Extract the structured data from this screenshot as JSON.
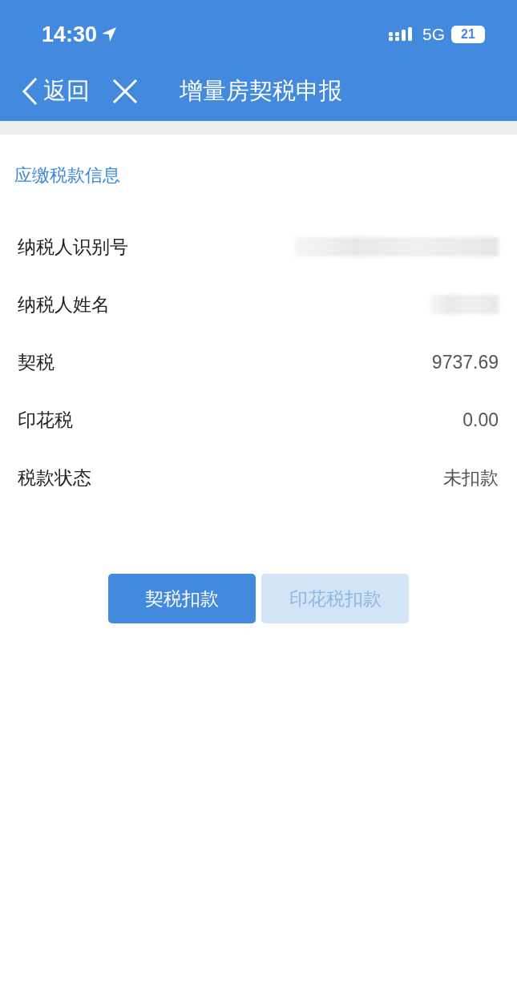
{
  "status_bar": {
    "time": "14:30",
    "network": "5G",
    "battery": "21"
  },
  "nav_bar": {
    "back": "返回",
    "title": "增量房契税申报"
  },
  "section": {
    "title": "应缴税款信息"
  },
  "rows": [
    {
      "label": "纳税人识别号",
      "kind": "redacted"
    },
    {
      "label": "纳税人姓名",
      "kind": "redacted_short"
    },
    {
      "label": "契税",
      "kind": "value",
      "value": "9737.69"
    },
    {
      "label": "印花税",
      "kind": "value",
      "value": "0.00"
    },
    {
      "label": "税款状态",
      "kind": "value",
      "value": "未扣款"
    }
  ],
  "buttons": [
    {
      "label": "契税扣款",
      "disabled": false
    },
    {
      "label": "印花税扣款",
      "disabled": true
    }
  ]
}
